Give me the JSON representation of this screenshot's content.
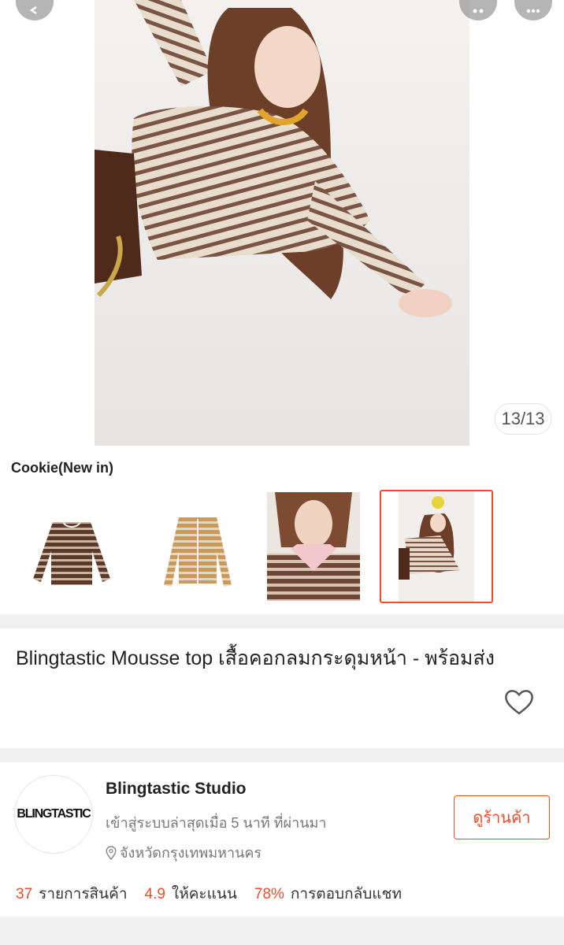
{
  "gallery": {
    "counter": "13/13",
    "variant_label": "Cookie(New in)",
    "thumbnails": [
      {
        "name": "brown striped top flat lay"
      },
      {
        "name": "tan striped top flat lay"
      },
      {
        "name": "model wearing top close-up"
      },
      {
        "name": "model posing photo",
        "selected": true
      }
    ]
  },
  "product": {
    "title": "Blingtastic Mousse top เสื้อคอกลมกระดุมหน้า - พร้อมส่ง"
  },
  "shop": {
    "logo_text": "BLINGTASTIC",
    "name": "Blingtastic Studio",
    "status": "เข้าสู่ระบบล่าสุดเมื่อ 5 นาที ที่ผ่านมา",
    "location": "จังหวัดกรุงเทพมหานคร",
    "view_button": "ดูร้านค้า",
    "stats": {
      "products_count": "37",
      "products_label": "รายการสินค้า",
      "rating": "4.9",
      "rating_label": "ให้คะแนน",
      "chat_rate": "78%",
      "chat_label": "การตอบกลับแชท"
    }
  },
  "colors": {
    "accent": "#ee4d2d"
  }
}
